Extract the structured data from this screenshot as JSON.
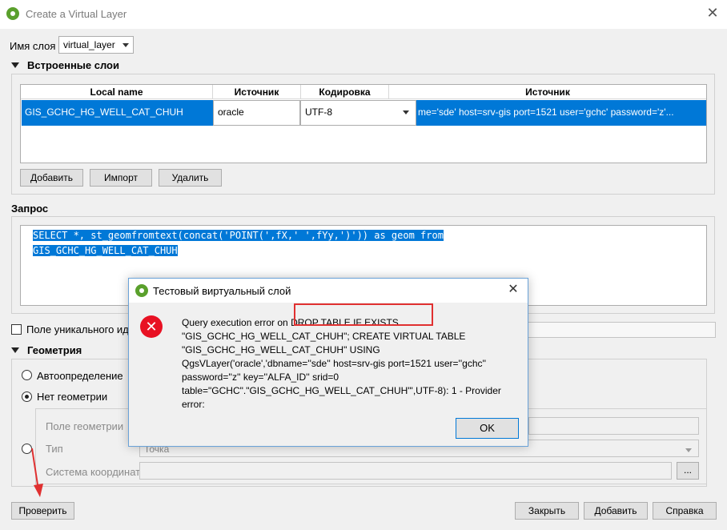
{
  "window": {
    "title": "Create a Virtual Layer",
    "close_icon": "close-icon"
  },
  "layer_name": {
    "label": "Имя слоя",
    "value": "virtual_layer"
  },
  "embedded": {
    "section_title": "Встроенные слои",
    "columns": [
      "Local name",
      "Источник",
      "Кодировка",
      "Источник"
    ],
    "row": {
      "local_name": "GIS_GCHC_HG_WELL_CAT_CHUH",
      "provider": "oracle",
      "encoding": "UTF-8",
      "source": "me='sde' host=srv-gis port=1521 user='gchc' password='z'..."
    },
    "buttons": {
      "add": "Добавить",
      "import": "Импорт",
      "delete": "Удалить"
    }
  },
  "query": {
    "section_title": "Запрос",
    "line1": "SELECT *, st_geomfromtext(concat('POINT(',fX,' ',fYy,')')) as geom from",
    "line2": "GIS_GCHC_HG_WELL_CAT_CHUH"
  },
  "unique_id": {
    "label": "Поле уникального иде"
  },
  "geometry": {
    "section_title": "Геометрия",
    "auto_label": "Автоопределение",
    "none_label": "Нет геометрии",
    "field_label": "Поле геометрии",
    "type_label": "Тип",
    "type_value": "Точка",
    "crs_label": "Система координат",
    "crs_button": "..."
  },
  "footer": {
    "test": "Проверить",
    "close": "Закрыть",
    "add": "Добавить",
    "help": "Справка"
  },
  "dialog": {
    "title": "Тестовый виртуальный слой",
    "message": "Query execution error on DROP TABLE IF EXISTS \"GIS_GCHC_HG_WELL_CAT_CHUH\"; CREATE VIRTUAL TABLE \"GIS_GCHC_HG_WELL_CAT_CHUH\" USING QgsVLayer('oracle','dbname=''sde'' host=srv-gis port=1521 user=''gchc'' password=''z'' key=''ALFA_ID'' srid=0 table=\"GCHC\".\"GIS_GCHC_HG_WELL_CAT_CHUH\"',UTF-8): 1 - Provider error:",
    "ok": "OK"
  },
  "colors": {
    "accent": "#0078d7",
    "error": "#e81123",
    "annotation": "#e03030",
    "qgis_green": "#5aa02c"
  }
}
